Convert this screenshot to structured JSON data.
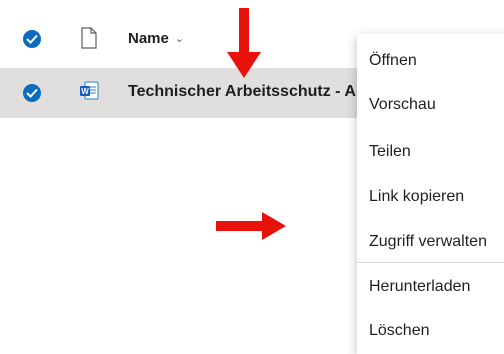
{
  "colors": {
    "accent": "#0f6cbd",
    "selected_row": "#e1dfdd",
    "annotation_arrow": "#e8120a"
  },
  "header": {
    "column_name_label": "Name",
    "sort_indicator": "⌄",
    "select_all_checked": true,
    "file_type_icon": "document-icon"
  },
  "files": [
    {
      "name": "Technischer Arbeitsschutz - A",
      "type_icon": "word-icon",
      "checked": true
    }
  ],
  "context_menu": {
    "items": [
      "Öffnen",
      "Vorschau",
      "Teilen",
      "Link kopieren",
      "Zugriff verwalten",
      "Herunterladen",
      "Löschen"
    ]
  },
  "annotations": [
    {
      "type": "arrow",
      "direction": "down"
    },
    {
      "type": "arrow",
      "direction": "right"
    }
  ]
}
